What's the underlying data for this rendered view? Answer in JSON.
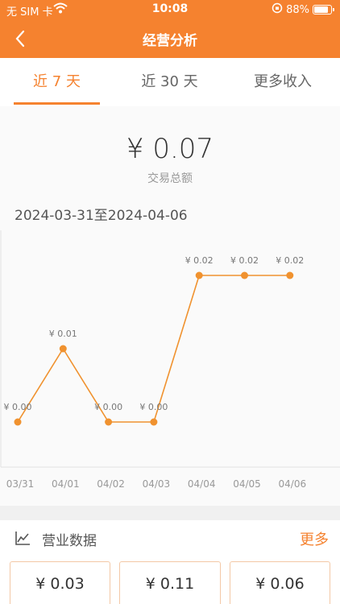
{
  "status_bar": {
    "carrier": "无 SIM 卡",
    "time": "10:08",
    "battery": "88%",
    "battery_level": 0.88
  },
  "header": {
    "title": "经营分析"
  },
  "tabs": [
    {
      "label": "近 7 天",
      "active": true
    },
    {
      "label": "近 30 天",
      "active": false
    },
    {
      "label": "更多收入",
      "active": false
    }
  ],
  "summary": {
    "total": "¥ 0.07",
    "total_label": "交易总额",
    "date_range": "2024-03-31至2024-04-06"
  },
  "chart_data": {
    "type": "line",
    "x": [
      "03/31",
      "04/01",
      "04/02",
      "04/03",
      "04/04",
      "04/05",
      "04/06"
    ],
    "values": [
      0.0,
      0.01,
      0.0,
      0.0,
      0.02,
      0.02,
      0.02
    ],
    "data_labels": [
      "¥ 0.00",
      "¥ 0.01",
      "¥ 0.00",
      "¥ 0.00",
      "¥ 0.02",
      "¥ 0.02",
      "¥ 0.02"
    ],
    "ylim": [
      0,
      0.02
    ],
    "color": "#f0922f",
    "grid": false
  },
  "business": {
    "title": "营业数据",
    "more": "更多",
    "cards": [
      "¥ 0.03",
      "¥ 0.11",
      "¥ 0.06"
    ]
  },
  "colors": {
    "accent": "#f5822f"
  }
}
